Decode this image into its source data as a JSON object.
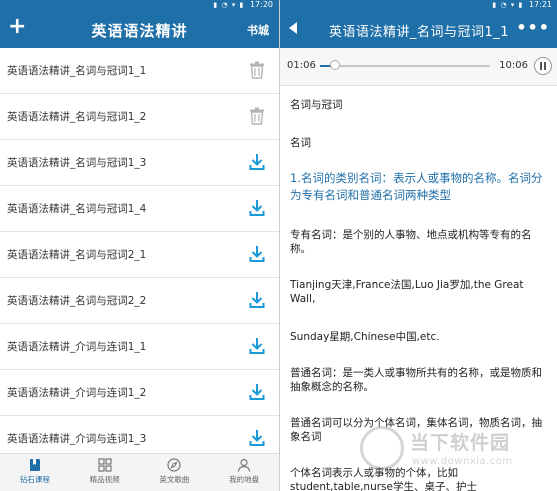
{
  "colors": {
    "brand": "#1f6fa8",
    "accent": "#1a9ad6",
    "header_text": "#ffffff"
  },
  "left": {
    "status_time": "17:20",
    "header": {
      "add_icon": "plus-icon",
      "title": "英语语法精讲",
      "store": "书城"
    },
    "lessons": [
      {
        "label": "英语语法精讲_名词与冠词1_1",
        "action_icon": "trash-icon"
      },
      {
        "label": "英语语法精讲_名词与冠词1_2",
        "action_icon": "trash-icon"
      },
      {
        "label": "英语语法精讲_名词与冠词1_3",
        "action_icon": "download-icon"
      },
      {
        "label": "英语语法精讲_名词与冠词1_4",
        "action_icon": "download-icon"
      },
      {
        "label": "英语语法精讲_名词与冠词2_1",
        "action_icon": "download-icon"
      },
      {
        "label": "英语语法精讲_名词与冠词2_2",
        "action_icon": "download-icon"
      },
      {
        "label": "英语语法精讲_介词与连词1_1",
        "action_icon": "download-icon"
      },
      {
        "label": "英语语法精讲_介词与连词1_2",
        "action_icon": "download-icon"
      },
      {
        "label": "英语语法精讲_介词与连词1_3",
        "action_icon": "download-icon"
      }
    ],
    "nav": [
      {
        "label": "钻石课程",
        "icon": "book-icon",
        "active": true
      },
      {
        "label": "精品视频",
        "icon": "grid-icon",
        "active": false
      },
      {
        "label": "英文歌曲",
        "icon": "compass-icon",
        "active": false
      },
      {
        "label": "我的地盘",
        "icon": "user-icon",
        "active": false
      }
    ]
  },
  "right": {
    "status_time": "17:21",
    "header": {
      "back_icon": "back-arrow-icon",
      "title": "英语语法精讲_名词与冠词1_1",
      "more_icon": "more-icon"
    },
    "player": {
      "current": "01:06",
      "total": "10:06",
      "progress": 0.09,
      "pause_icon": "pause-icon"
    },
    "content": {
      "heading1": "名词与冠词",
      "heading2": "名词",
      "section_title": "1.名词的类别名词：表示人或事物的名称。名词分为专有名词和普通名词两种类型",
      "p1": "专有名词：是个别的人事物、地点或机构等专有的名称。",
      "p2": "Tianjing天津,France法国,Luo Jia罗加,the Great Wall,",
      "p3": "Sunday星期,Chinese中国,etc.",
      "p4": "普通名词：是一类人或事物所共有的名称，或是物质和抽象概念的名称。",
      "p5": "普通名词可以分为个体名词，集体名词，物质名词，抽象名词",
      "p6": "个体名词表示人或事物的个体，比如student,table,nurse学生、桌子、护士"
    },
    "watermark": {
      "text": "当下软件园",
      "url": "www.downxia.com"
    }
  }
}
